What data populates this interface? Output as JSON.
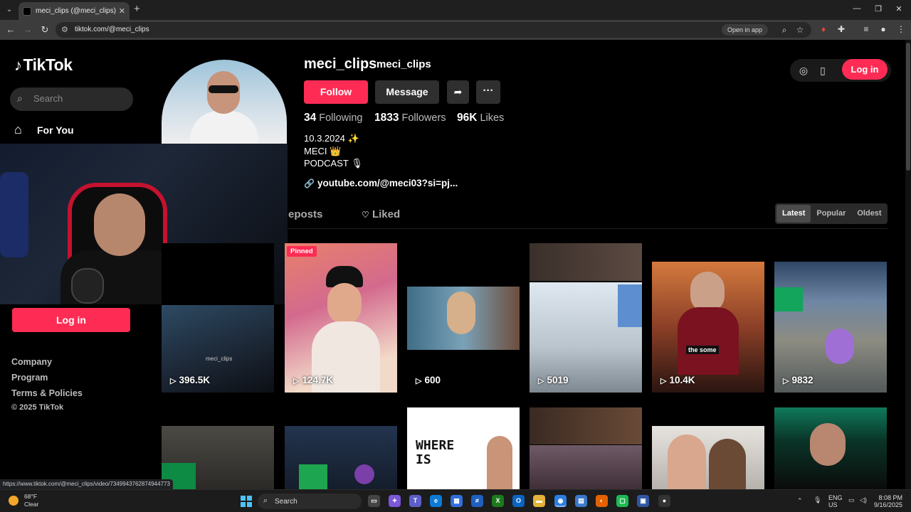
{
  "browser": {
    "tab_title": "meci_clips (@meci_clips) | TikTok",
    "tab_close": "✕",
    "new_tab": "+",
    "url": "tiktok.com/@meci_clips",
    "open_in_app": "Open in app",
    "status_url": "https://www.tiktok.com/@meci_clips/video/7349943762874944773"
  },
  "sidebar": {
    "logo": "TikTok",
    "search_placeholder": "Search",
    "for_you": "For You",
    "login": "Log in",
    "footer": [
      "Company",
      "Program",
      "Terms & Policies"
    ],
    "copyright": "© 2025 TikTok"
  },
  "profile": {
    "username": "meci_clips",
    "nickname": "meci_clips",
    "follow": "Follow",
    "message": "Message",
    "more": "···",
    "following_count": "34",
    "following_label": "Following",
    "followers_count": "1833",
    "followers_label": "Followers",
    "likes_count": "96K",
    "likes_label": "Likes",
    "bio": [
      "10.3.2024 ✨",
      "MECI 👑",
      "PODCAST 🎙"
    ],
    "link": "youtube.com/@meci03?si=pj..."
  },
  "tabs": {
    "reposts": "eposts",
    "liked": "Liked"
  },
  "sort": [
    "Latest",
    "Popular",
    "Oldest"
  ],
  "sort_active": "Latest",
  "header_login": "Log in",
  "videos": [
    {
      "views": "396.5K",
      "pinned": false,
      "caption": "meci_clips"
    },
    {
      "views": "124.7K",
      "pinned": true,
      "pin_label": "Pinned"
    },
    {
      "views": "600",
      "pinned": false
    },
    {
      "views": "5019",
      "pinned": false
    },
    {
      "views": "10.4K",
      "pinned": false,
      "caption": "the some"
    },
    {
      "views": "9832",
      "pinned": false
    }
  ],
  "second_row_text": "WHERE IS",
  "taskbar": {
    "temp": "68°F",
    "weather": "Clear",
    "search": "Search",
    "lang": "ENG",
    "region": "US",
    "time": "8:08 PM",
    "date": "9/16/2025"
  },
  "colors": {
    "accent": "#fe2c55",
    "background": "#000000"
  }
}
